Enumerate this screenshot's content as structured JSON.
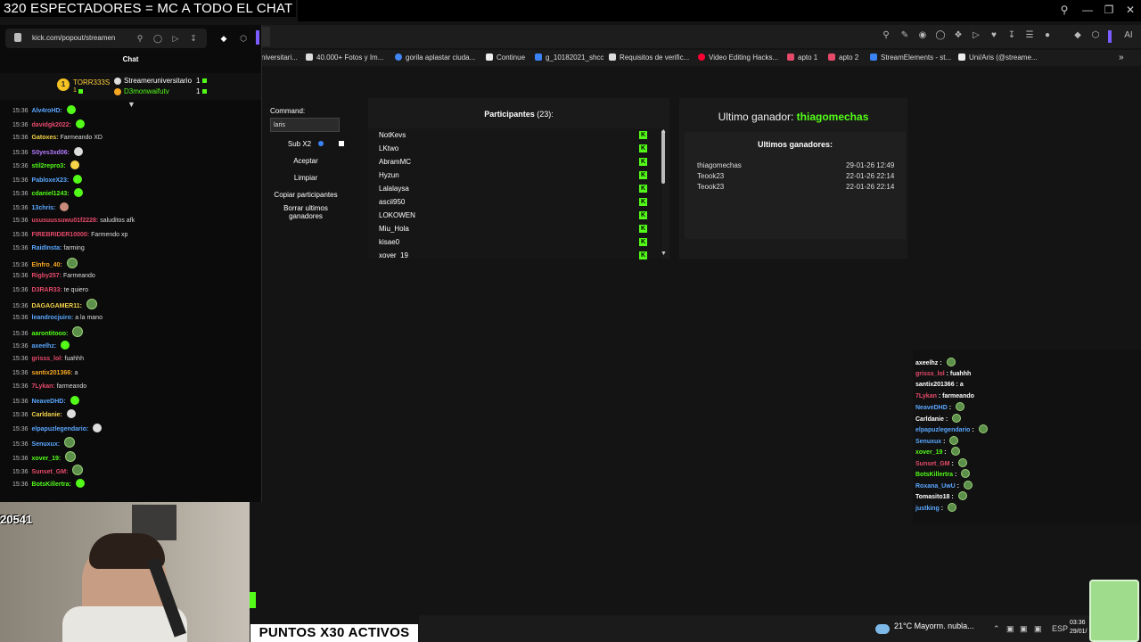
{
  "overlay_title": "320 ESPECTADORES = MC A TODO EL CHAT",
  "popout": {
    "url": "kick.com/popout/streamen",
    "chat_title": "Chat",
    "gifters": {
      "top_name": "TORR333S",
      "top_count": "1",
      "second_name": "Streameruniversitario",
      "second_count": "1",
      "third_name": "D3monwaifutv",
      "third_count": "1"
    },
    "messages": [
      {
        "time": "15:36",
        "user": "Alv4roHD:",
        "color": "#5aa7ff",
        "text": "",
        "emote": "green"
      },
      {
        "time": "15:36",
        "user": "davidgk2022:",
        "color": "#e64a6a",
        "text": "",
        "emote": "green"
      },
      {
        "time": "15:36",
        "user": "Gatoxes:",
        "color": "#f5d44a",
        "text": "Farmeando XD",
        "emote": ""
      },
      {
        "time": "15:36",
        "user": "S0yes3xd06:",
        "color": "#b57bff",
        "text": "",
        "emote": "gray"
      },
      {
        "time": "15:36",
        "user": "stil2repro3:",
        "color": "#53fc18",
        "text": "",
        "emote": "yel"
      },
      {
        "time": "15:36",
        "user": "PabloxeX23:",
        "color": "#5aa7ff",
        "text": "",
        "emote": "green"
      },
      {
        "time": "15:36",
        "user": "cdaniel1243:",
        "color": "#53fc18",
        "text": "",
        "emote": "green"
      },
      {
        "time": "15:36",
        "user": "13chris:",
        "color": "#5aa7ff",
        "text": "",
        "emote": "pink"
      },
      {
        "time": "15:36",
        "user": "ususuussuwu01f2228:",
        "color": "#e64a6a",
        "text": "saluditos afk",
        "emote": ""
      },
      {
        "time": "15:36",
        "user": "FIREBRIDER10000:",
        "color": "#e64a6a",
        "text": "Farmendo xp",
        "emote": ""
      },
      {
        "time": "15:36",
        "user": "RaidInsta:",
        "color": "#5aa7ff",
        "text": "farming",
        "emote": ""
      },
      {
        "time": "15:36",
        "user": "Elnfro_40:",
        "color": "#f5a623",
        "text": "",
        "emote": "frog"
      },
      {
        "time": "15:36",
        "user": "Rigby257:",
        "color": "#e64a6a",
        "text": "Farmeando",
        "emote": ""
      },
      {
        "time": "15:36",
        "user": "D3RAR33:",
        "color": "#e64a6a",
        "text": "te quiero",
        "emote": ""
      },
      {
        "time": "15:36",
        "user": "DAGAGAMER11:",
        "color": "#f5d44a",
        "text": "",
        "emote": "frog"
      },
      {
        "time": "15:36",
        "user": "leandrocjuiro:",
        "color": "#5aa7ff",
        "text": "a la mano",
        "emote": ""
      },
      {
        "time": "15:36",
        "user": "aarontitooo:",
        "color": "#53fc18",
        "text": "",
        "emote": "frog"
      },
      {
        "time": "15:36",
        "user": "axeelhz:",
        "color": "#5aa7ff",
        "text": "",
        "emote": "green"
      },
      {
        "time": "15:36",
        "user": "grisss_lol:",
        "color": "#e64a6a",
        "text": "fuahhh",
        "emote": ""
      },
      {
        "time": "15:36",
        "user": "santix201366:",
        "color": "#f5a623",
        "text": "a",
        "emote": ""
      },
      {
        "time": "15:36",
        "user": "7Lykan:",
        "color": "#e64a6a",
        "text": "farmeando",
        "emote": ""
      },
      {
        "time": "15:36",
        "user": "NeaveDHD:",
        "color": "#5aa7ff",
        "text": "",
        "emote": "green"
      },
      {
        "time": "15:36",
        "user": "Carldanie:",
        "color": "#f5d44a",
        "text": "",
        "emote": "gray"
      },
      {
        "time": "15:36",
        "user": "elpapuzlegendario:",
        "color": "#5aa7ff",
        "text": "",
        "emote": "gray"
      },
      {
        "time": "15:36",
        "user": "Senuxux:",
        "color": "#5aa7ff",
        "text": "",
        "emote": "frog"
      },
      {
        "time": "15:36",
        "user": "xover_19:",
        "color": "#53fc18",
        "text": "",
        "emote": "frog"
      },
      {
        "time": "15:36",
        "user": "Sunset_GM:",
        "color": "#e64a6a",
        "text": "",
        "emote": "frog"
      },
      {
        "time": "15:36",
        "user": "BotsKillertra:",
        "color": "#53fc18",
        "text": "",
        "emote": "green"
      }
    ]
  },
  "stream": {
    "counter": "20541",
    "banner": "PUNTOS X30 ACTIVOS"
  },
  "bookmarks": [
    "niversitari...",
    "40.000+ Fotos y Im...",
    "gorila aplastar ciuda...",
    "Continue",
    "g_10182021_shcc",
    "Requisitos de verific...",
    "Video Editing Hacks...",
    "apto 1",
    "apto 2",
    "StreamElements - st...",
    "Uni/Aris (@streame..."
  ],
  "giveaway": {
    "command_label": "Command:",
    "command_value": "laris",
    "sub_label": "Sub X2",
    "accept": "Aceptar",
    "clear": "Limpiar",
    "copy": "Copiar participantes",
    "delete_winners": "Borrar ultimos ganadores",
    "participants_label": "Participantes",
    "participants_count": "(23):",
    "participants": [
      "NotKevs",
      "LKtwo",
      "AbramMC",
      "Hyzun",
      "Lalalaysa",
      "ascii950",
      "LOKOWEN",
      "Miu_Hola",
      "kisae0",
      "xover_19"
    ],
    "last_winner_label": "Ultimo ganador:",
    "last_winner": "thiagomechas",
    "last_winners_title": "Ultimos ganadores:",
    "winners": [
      {
        "name": "thiagomechas",
        "date": "29-01-26 12:49"
      },
      {
        "name": "Teook23",
        "date": "22-01-26 22:14"
      },
      {
        "name": "Teook23",
        "date": "22-01-26 22:14"
      }
    ]
  },
  "overlay_chat": [
    {
      "user": "axeelhz",
      "color": "#ffffff",
      "text": ""
    },
    {
      "user": "grisss_lol",
      "color": "#e64a6a",
      "text": "fuahhh"
    },
    {
      "user": "santix201366",
      "color": "#ffffff",
      "text": "a"
    },
    {
      "user": "7Lykan",
      "color": "#e64a6a",
      "text": "farmeando"
    },
    {
      "user": "NeaveDHD",
      "color": "#5aa7ff",
      "text": ""
    },
    {
      "user": "Carldanie",
      "color": "#ffffff",
      "text": ""
    },
    {
      "user": "elpapuzlegendario",
      "color": "#5aa7ff",
      "text": ""
    },
    {
      "user": "Senuxux",
      "color": "#5aa7ff",
      "text": ""
    },
    {
      "user": "xover_19",
      "color": "#53fc18",
      "text": ""
    },
    {
      "user": "Sunset_GM",
      "color": "#e64a6a",
      "text": ""
    },
    {
      "user": "BotsKillertra",
      "color": "#53fc18",
      "text": ""
    },
    {
      "user": "Roxana_UwU",
      "color": "#5aa7ff",
      "text": ""
    },
    {
      "user": "Tomasito18",
      "color": "#ffffff",
      "text": ""
    },
    {
      "user": "justking",
      "color": "#5aa7ff",
      "text": ""
    }
  ],
  "taskbar": {
    "weather": "21°C  Mayorm. nubla...",
    "lang": "ESP",
    "time": "03:36",
    "date": "29/01/"
  },
  "colors": {
    "kick_green": "#53fc18"
  }
}
